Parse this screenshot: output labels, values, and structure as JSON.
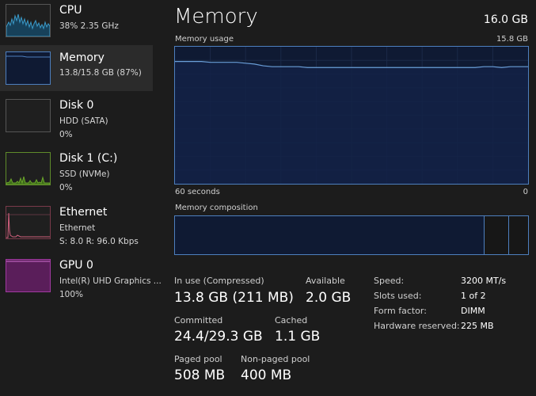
{
  "sidebar": {
    "items": [
      {
        "title": "CPU",
        "line1": "38%  2.35 GHz",
        "line2": "",
        "color": "#3a9ac9",
        "graph_icon": "cpu-graph-icon"
      },
      {
        "title": "Memory",
        "line1": "13.8/15.8 GB (87%)",
        "line2": "",
        "color": "#4d7fbe",
        "graph_icon": "memory-graph-icon"
      },
      {
        "title": "Disk 0",
        "line1": "HDD (SATA)",
        "line2": "0%",
        "color": "#5a5a5a",
        "graph_icon": "disk-graph-icon"
      },
      {
        "title": "Disk 1 (C:)",
        "line1": "SSD (NVMe)",
        "line2": "0%",
        "color": "#6aa52a",
        "graph_icon": "disk-graph-icon"
      },
      {
        "title": "Ethernet",
        "line1": "Ethernet",
        "line2": "S: 8.0  R: 96.0 Kbps",
        "color": "#b0506a",
        "graph_icon": "ethernet-graph-icon"
      },
      {
        "title": "GPU 0",
        "line1": "Intel(R) UHD Graphics ...",
        "line2": "100%",
        "color": "#a03aa0",
        "graph_icon": "gpu-graph-icon"
      }
    ]
  },
  "main": {
    "title": "Memory",
    "total": "16.0 GB",
    "usage_label": "Memory usage",
    "usage_max": "15.8 GB",
    "time_left": "60 seconds",
    "time_right": "0",
    "composition_label": "Memory composition",
    "composition": {
      "in_use_fraction": 0.875,
      "standby_fraction": 0.07
    },
    "usage_series_gb": [
      14.1,
      14.1,
      14.1,
      14.1,
      14.0,
      14.0,
      14.0,
      14.0,
      13.9,
      13.8,
      13.6,
      13.5,
      13.5,
      13.5,
      13.5,
      13.4,
      13.4,
      13.4,
      13.4,
      13.4,
      13.4,
      13.4,
      13.4,
      13.4,
      13.4,
      13.4,
      13.4,
      13.4,
      13.4,
      13.4,
      13.4,
      13.4,
      13.4,
      13.4,
      13.4,
      13.5,
      13.5,
      13.4,
      13.5,
      13.5,
      13.5
    ],
    "stats": {
      "in_use_label": "In use (Compressed)",
      "in_use_value": "13.8 GB (211 MB)",
      "available_label": "Available",
      "available_value": "2.0 GB",
      "committed_label": "Committed",
      "committed_value": "24.4/29.3 GB",
      "cached_label": "Cached",
      "cached_value": "1.1 GB",
      "paged_label": "Paged pool",
      "paged_value": "508 MB",
      "nonpaged_label": "Non-paged pool",
      "nonpaged_value": "400 MB"
    },
    "details": [
      {
        "label": "Speed:",
        "value": "3200 MT/s"
      },
      {
        "label": "Slots used:",
        "value": "1 of 2"
      },
      {
        "label": "Form factor:",
        "value": "DIMM"
      },
      {
        "label": "Hardware reserved:",
        "value": "225 MB"
      }
    ]
  }
}
